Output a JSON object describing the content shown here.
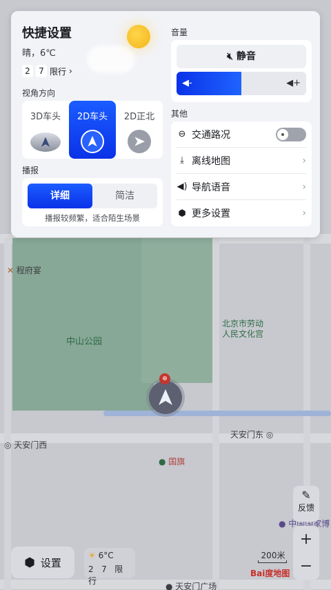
{
  "map": {
    "labels": {
      "restaurant": "程府宴",
      "park": "中山公园",
      "palace": "北京市劳动\n人民文化宫",
      "west": "天安门西",
      "east": "天安门东",
      "flag": "国旗",
      "square": "天安门广场",
      "museum": "中国国家博"
    }
  },
  "panel": {
    "title": "快捷设置",
    "weather": "晴，6℃",
    "plate_digits": [
      "2",
      "7"
    ],
    "limit_label": "限行",
    "view": {
      "label": "视角方向",
      "options": [
        "3D车头",
        "2D车头",
        "2D正北"
      ],
      "selected": "2D车头"
    },
    "broadcast": {
      "label": "播报",
      "tabs": [
        "详细",
        "简洁"
      ],
      "selected": "详细",
      "description": "播报较频繁，适合陌生场景"
    },
    "volume": {
      "label": "音量",
      "mute_label": "静音",
      "level_percent": 50
    },
    "other": {
      "label": "其他",
      "items": [
        "交通路况",
        "离线地图",
        "导航语音",
        "更多设置"
      ],
      "traffic_on": false
    }
  },
  "bottom": {
    "settings_label": "设置",
    "temp": "6°C",
    "plate_digits": [
      "2",
      "7"
    ],
    "limit_label": "限行",
    "feedback_label": "反馈",
    "zoom_in": "+",
    "zoom_out": "−",
    "scale_label": "200米",
    "brand": "Bai度地图"
  }
}
